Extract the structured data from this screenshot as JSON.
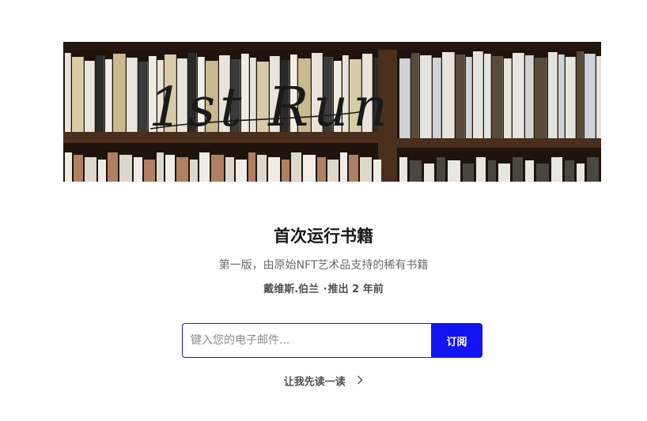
{
  "banner": {
    "logo_text": "1st Run",
    "colors": {
      "shelf": "#4a2f1c",
      "back": "#1e140d",
      "spine_light": "#e8e4dc",
      "spine_cream": "#d8cca8",
      "spine_dark": "#2a2a2a"
    }
  },
  "book": {
    "title": "首次运行书籍",
    "subtitle": "第一版，由原始NFT艺术品支持的稀有书籍",
    "author": "戴维斯.伯兰",
    "separator": "·",
    "published": "推出 2 年前"
  },
  "subscribe": {
    "placeholder": "键入您的电子邮件...",
    "value": "",
    "button_label": "订阅",
    "accent_color": "#1414f0"
  },
  "read_link": {
    "label": "让我先读一读",
    "icon": "chevron-right-icon"
  }
}
